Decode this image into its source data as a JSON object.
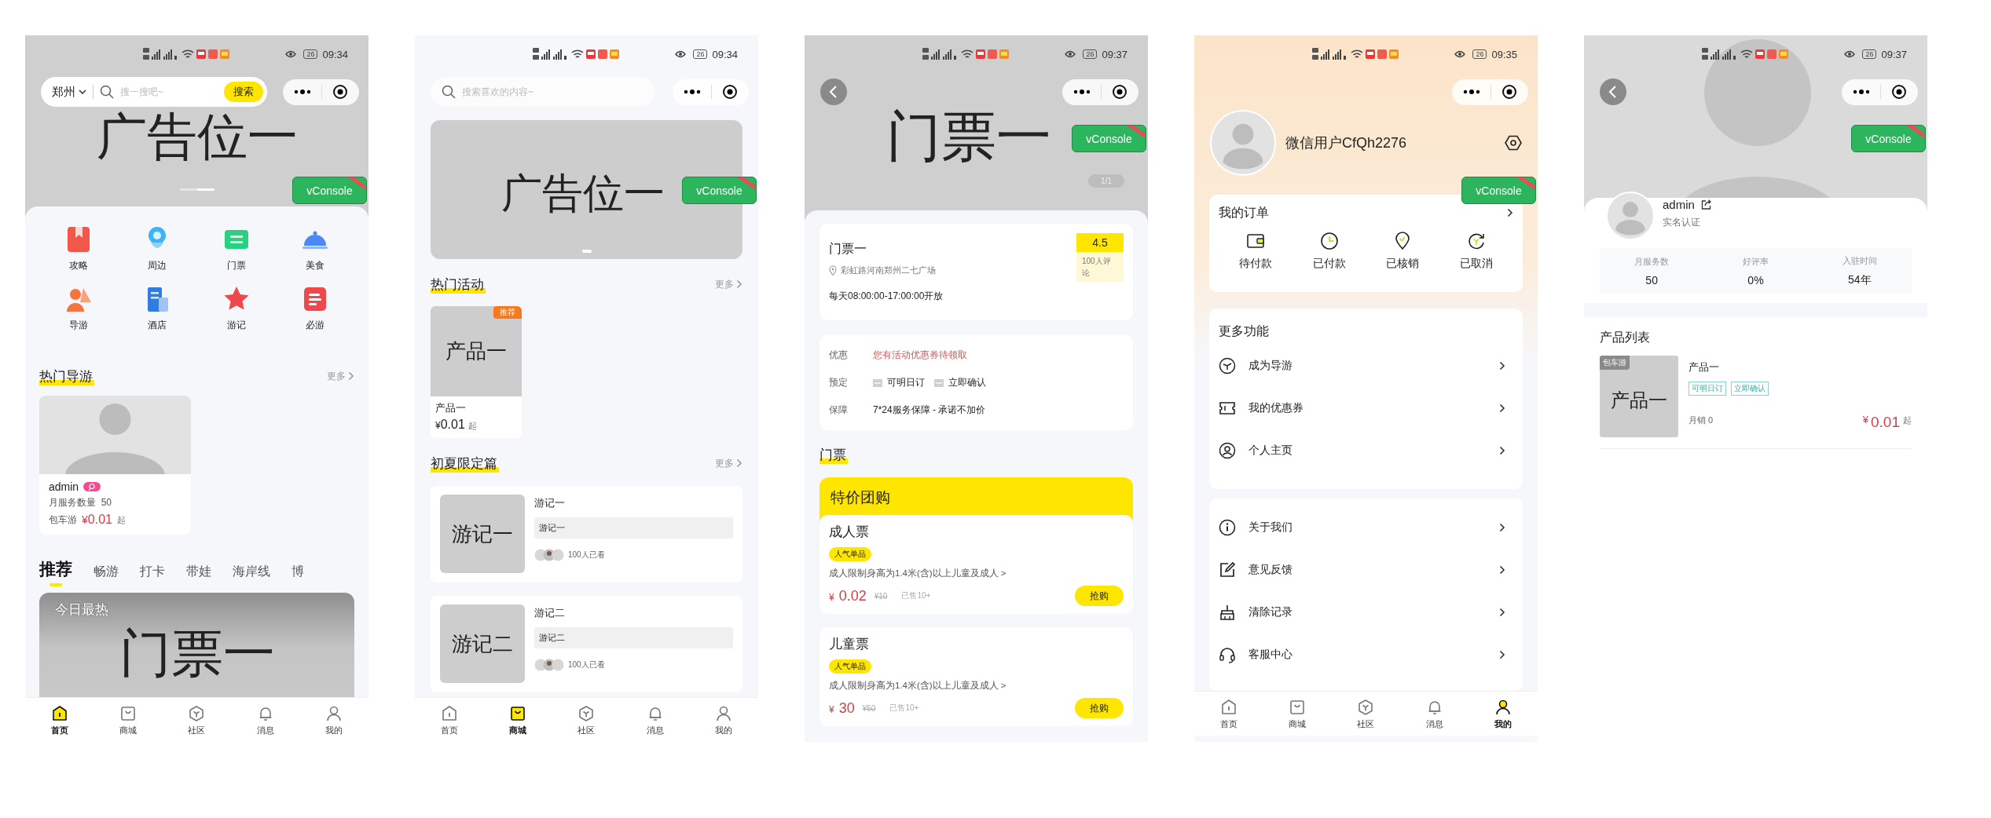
{
  "screens": [
    {
      "kind": "home",
      "time": "09:34",
      "battery": "26",
      "vconsole": "vConsole",
      "search": {
        "city": "郑州",
        "placeholder": "搜一搜吧~",
        "button": "搜索"
      },
      "banner": {
        "text": "广告位一"
      },
      "categories": [
        "攻略",
        "周边",
        "门票",
        "美食",
        "导游",
        "酒店",
        "游记",
        "必游"
      ],
      "guides_section": {
        "title": "热门导游",
        "more": "更多"
      },
      "guides": [
        {
          "name": "admin",
          "service": "月服务数量  50",
          "type": "包车游",
          "currency": "¥",
          "price": "0.01",
          "suffix": "起"
        }
      ],
      "feed_tabs": [
        {
          "label": "推荐",
          "selected": true
        },
        {
          "label": "畅游",
          "selected": false
        },
        {
          "label": "打卡",
          "selected": false
        },
        {
          "label": "带娃",
          "selected": false
        },
        {
          "label": "海岸线",
          "selected": false
        },
        {
          "label": "博",
          "selected": false
        }
      ],
      "feed_card": {
        "caption": "今日最热",
        "title": "门票一"
      },
      "tabbar": [
        {
          "label": "首页",
          "selected": true
        },
        {
          "label": "商城",
          "selected": false
        },
        {
          "label": "社区",
          "selected": false
        },
        {
          "label": "消息",
          "selected": false
        },
        {
          "label": "我的",
          "selected": false
        }
      ]
    },
    {
      "kind": "mall",
      "time": "09:34",
      "battery": "26",
      "vconsole": "vConsole",
      "search": {
        "placeholder": "搜索喜欢的内容~"
      },
      "banner": {
        "text": "广告位一"
      },
      "hot_section": {
        "title": "热门活动",
        "more": "更多"
      },
      "products": [
        {
          "badge": "推荐",
          "image_text": "产品一",
          "name": "产品一",
          "currency": "¥",
          "price": "0.01",
          "suffix": "起"
        }
      ],
      "notes_section": {
        "title": "初夏限定篇",
        "more": "更多"
      },
      "notes": [
        {
          "image_text": "游记一",
          "title": "游记一",
          "summary": "游记一",
          "views": "100人已看"
        },
        {
          "image_text": "游记二",
          "title": "游记二",
          "summary": "游记二",
          "views": "100人已看"
        }
      ],
      "tabbar": [
        {
          "label": "首页",
          "selected": false
        },
        {
          "label": "商城",
          "selected": true
        },
        {
          "label": "社区",
          "selected": false
        },
        {
          "label": "消息",
          "selected": false
        },
        {
          "label": "我的",
          "selected": false
        }
      ]
    },
    {
      "kind": "ticket",
      "time": "09:37",
      "battery": "26",
      "vconsole": "vConsole",
      "hero": {
        "text": "门票一",
        "pager": "1/1"
      },
      "info": {
        "name": "门票一",
        "address": "彩虹路河南郑州二七广场",
        "rating": "4.5",
        "reviews": "100人评论",
        "hours": "每天08:00:00-17:00:00开放"
      },
      "services": [
        {
          "label": "优惠",
          "kind": "coupon",
          "value": "您有活动优惠券待领取"
        },
        {
          "label": "预定",
          "kind": "tags",
          "tags": [
            "可明日订",
            "立即确认"
          ]
        },
        {
          "label": "保障",
          "kind": "text",
          "value": "7*24服务保障 - 承诺不加价"
        }
      ],
      "tickets_section": {
        "title": "门票"
      },
      "group_title": "特价团购",
      "tickets": [
        {
          "name": "成人票",
          "tag": "人气单品",
          "desc": "成人限制身高为1.4米(含)以上儿童及成人 >",
          "currency": "¥",
          "price": "0.02",
          "original": "¥10",
          "sold": "已售10+",
          "button": "抢购"
        },
        {
          "name": "儿童票",
          "tag": "人气单品",
          "desc": "成人限制身高为1.4米(含)以上儿童及成人 >",
          "currency": "¥",
          "price": "30",
          "original": "¥50",
          "sold": "已售10+",
          "button": "抢购"
        }
      ]
    },
    {
      "kind": "mine",
      "time": "09:35",
      "battery": "26",
      "vconsole": "vConsole",
      "user": "微信用户CfQh2276",
      "orders": {
        "title": "我的订单",
        "items": [
          "待付款",
          "已付款",
          "已核销",
          "已取消"
        ]
      },
      "more": {
        "title": "更多功能",
        "items": [
          "成为导游",
          "我的优惠券",
          "个人主页"
        ]
      },
      "others": [
        "关于我们",
        "意见反馈",
        "清除记录",
        "客服中心"
      ],
      "tabbar": [
        {
          "label": "首页",
          "selected": false
        },
        {
          "label": "商城",
          "selected": false
        },
        {
          "label": "社区",
          "selected": false
        },
        {
          "label": "消息",
          "selected": false
        },
        {
          "label": "我的",
          "selected": true
        }
      ]
    },
    {
      "kind": "guide",
      "time": "09:37",
      "battery": "26",
      "vconsole": "vConsole",
      "profile": {
        "name": "admin",
        "verified": "实名认证"
      },
      "stats": [
        {
          "label": "月服务数",
          "value": "50"
        },
        {
          "label": "好评率",
          "value": "0%"
        },
        {
          "label": "入驻时间",
          "value": "54年"
        }
      ],
      "products_title": "产品列表",
      "products": [
        {
          "image_text": "产品一",
          "category": "包车游",
          "name": "产品一",
          "tags": [
            "可明日订",
            "立即确认"
          ],
          "sales": "月销 0",
          "currency": "¥",
          "price": "0.01",
          "suffix": "起"
        }
      ]
    }
  ]
}
